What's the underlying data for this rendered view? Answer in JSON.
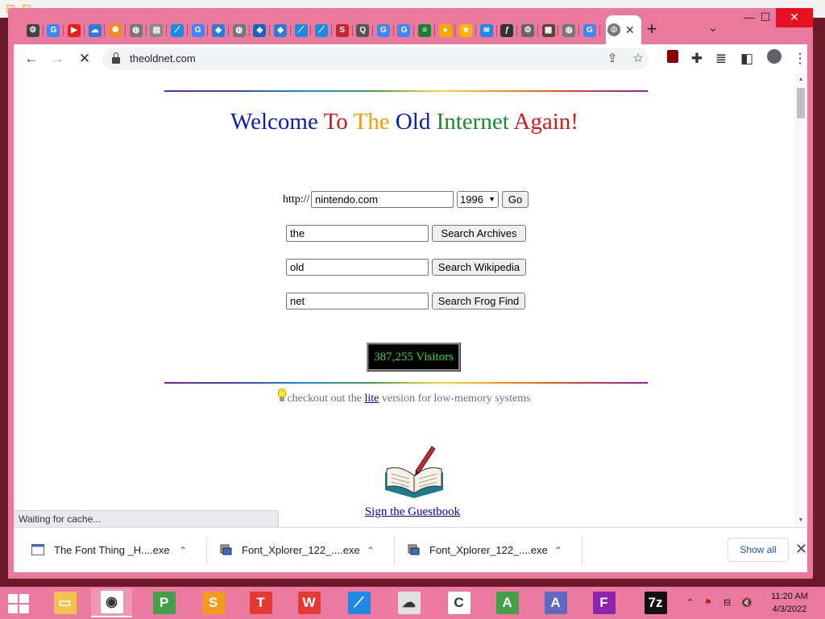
{
  "browser": {
    "address_url": "theoldnet.com",
    "tab_close_glyph": "✕",
    "new_tab_glyph": "+",
    "tab_search_glyph": "⌄",
    "window_controls": {
      "minimize": "—",
      "maximize": "☐",
      "close": "✕"
    },
    "toolbar_glyphs": {
      "back": "←",
      "forward": "→",
      "loading": "✕",
      "share": "⇪",
      "bookmark": "☆",
      "menu": "⋮"
    },
    "status_text": "Waiting for cache...",
    "tab_favicons": [
      {
        "name": "chrome-settings-icon",
        "color": "#444444",
        "glyph": "⚙"
      },
      {
        "name": "google-icon",
        "color": "#4285f4",
        "glyph": "G"
      },
      {
        "name": "youtube-icon",
        "color": "#e62117",
        "glyph": "▶"
      },
      {
        "name": "cloud-icon",
        "color": "#2e7bd6",
        "glyph": "☁"
      },
      {
        "name": "sun-icon",
        "color": "#f08c1a",
        "glyph": "✺"
      },
      {
        "name": "globe-icon",
        "color": "#777777",
        "glyph": "◍"
      },
      {
        "name": "document-icon",
        "color": "#888888",
        "glyph": "▤"
      },
      {
        "name": "chart-icon",
        "color": "#1e88e5",
        "glyph": "⟋"
      },
      {
        "name": "google-icon",
        "color": "#4285f4",
        "glyph": "G"
      },
      {
        "name": "map-pin-icon",
        "color": "#2e7bd6",
        "glyph": "◆"
      },
      {
        "name": "globe-icon",
        "color": "#777777",
        "glyph": "◍"
      },
      {
        "name": "cube-icon",
        "color": "#1565c0",
        "glyph": "◈"
      },
      {
        "name": "map-pin-icon",
        "color": "#2e7bd6",
        "glyph": "◆"
      },
      {
        "name": "chart-icon",
        "color": "#1e88e5",
        "glyph": "⟋"
      },
      {
        "name": "chart-icon",
        "color": "#1e88e5",
        "glyph": "⟋"
      },
      {
        "name": "s-icon",
        "color": "#c62828",
        "glyph": "S"
      },
      {
        "name": "q-icon",
        "color": "#555555",
        "glyph": "Q"
      },
      {
        "name": "google-icon",
        "color": "#4285f4",
        "glyph": "G"
      },
      {
        "name": "google-icon",
        "color": "#4285f4",
        "glyph": "G"
      },
      {
        "name": "spreadsheet-icon",
        "color": "#1e7e34",
        "glyph": "≡"
      },
      {
        "name": "coin-icon",
        "color": "#f2a900",
        "glyph": "●"
      },
      {
        "name": "star-icon",
        "color": "#f5b400",
        "glyph": "★"
      },
      {
        "name": "wifi-icon",
        "color": "#1e88e5",
        "glyph": "≋"
      },
      {
        "name": "font-icon",
        "color": "#333333",
        "glyph": "ƒ"
      },
      {
        "name": "gear-icon",
        "color": "#666666",
        "glyph": "⚙"
      },
      {
        "name": "image-icon",
        "color": "#5d4037",
        "glyph": "▦"
      },
      {
        "name": "globe-icon",
        "color": "#777777",
        "glyph": "◍"
      },
      {
        "name": "google-icon",
        "color": "#4285f4",
        "glyph": "G"
      }
    ],
    "active_tab_favicon": {
      "name": "globe-icon",
      "color": "#777777",
      "glyph": "◍"
    }
  },
  "page": {
    "headline_words": [
      "Welcome",
      "To",
      "The",
      "Old",
      "Internet",
      "Again!"
    ],
    "wayback": {
      "prefix": "http://",
      "url_value": "nintendo.com",
      "year_selected": "1996",
      "go_label": "Go"
    },
    "search_rows": [
      {
        "value": "the",
        "button": "Search Archives"
      },
      {
        "value": "old",
        "button": "Search Wikipedia"
      },
      {
        "value": "net",
        "button": "Search Frog Find"
      }
    ],
    "visitor_counter": "387,255 Visitors",
    "lite_line": {
      "before": "checkout out the ",
      "link": "lite",
      "after": " version for low-memory systems"
    },
    "guestbook_link": "Sign the Guestbook"
  },
  "downloads": {
    "items": [
      {
        "name": "The Font Thing _H....exe",
        "chevron": "⌃"
      },
      {
        "name": "Font_Xplorer_122_....exe",
        "chevron": "⌃"
      },
      {
        "name": "Font_Xplorer_122_....exe",
        "chevron": "⌃"
      }
    ],
    "show_all_label": "Show all",
    "close_glyph": "✕"
  },
  "taskbar": {
    "apps": [
      {
        "name": "file-explorer-icon",
        "color": "#f2c14e",
        "glyph": "▭",
        "active": false
      },
      {
        "name": "chrome-icon",
        "color": "#ffffff",
        "glyph": "◉",
        "active": true
      },
      {
        "name": "publisher-icon",
        "color": "#43a047",
        "glyph": "P",
        "active": false
      },
      {
        "name": "softmaker-icon",
        "color": "#f59b1c",
        "glyph": "S",
        "active": false
      },
      {
        "name": "textmaker-icon",
        "color": "#e53935",
        "glyph": "T",
        "active": false
      },
      {
        "name": "wps-icon",
        "color": "#e53935",
        "glyph": "W",
        "active": false
      },
      {
        "name": "chart-app-icon",
        "color": "#1e88e5",
        "glyph": "⟋",
        "active": false
      },
      {
        "name": "cloud-app-icon",
        "color": "#e0e0e0",
        "glyph": "☁",
        "active": false
      },
      {
        "name": "ccleaner-icon",
        "color": "#ffffff",
        "glyph": "C",
        "active": false
      },
      {
        "name": "font-app-icon",
        "color": "#43a047",
        "glyph": "A",
        "active": false
      },
      {
        "name": "font-creator-icon",
        "color": "#5c6bc0",
        "glyph": "A",
        "active": false
      },
      {
        "name": "fontforge-icon",
        "color": "#8e24aa",
        "glyph": "F",
        "active": false
      },
      {
        "name": "7zip-icon",
        "color": "#111111",
        "glyph": "7z",
        "active": false
      }
    ],
    "tray_glyphs": [
      "⌃",
      "⚑",
      "⊟",
      "🔇"
    ],
    "time": "11:20 AM",
    "date": "4/3/2022"
  }
}
